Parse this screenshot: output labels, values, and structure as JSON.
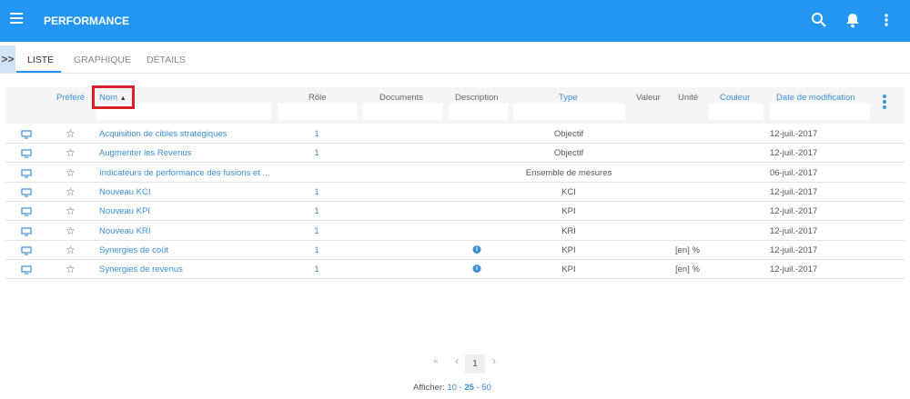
{
  "header": {
    "title": "PERFORMANCE",
    "icons": [
      "menu-icon",
      "search-icon",
      "bell-icon",
      "more-vert-icon"
    ]
  },
  "tabs": [
    {
      "label": "LISTE",
      "active": true
    },
    {
      "label": "GRAPHIQUE"
    },
    {
      "label": "DÉTAILS"
    }
  ],
  "expander": ">>",
  "columns": {
    "prefere": "Préféré",
    "nom": "Nom",
    "role": "Rôle",
    "documents": "Documents",
    "description": "Description",
    "type": "Type",
    "valeur": "Valeur",
    "unite": "Unité",
    "couleur": "Couleur",
    "date": "Date de modification"
  },
  "sort": {
    "column": "Nom",
    "direction": "ascending"
  },
  "rows": [
    {
      "name": "Acquisition de cibles stratégiques",
      "role": "1",
      "info": false,
      "type": "Objectif",
      "unit": "",
      "date": "12-juil.-2017"
    },
    {
      "name": "Augmenter les Revenus",
      "role": "1",
      "info": false,
      "type": "Objectif",
      "unit": "",
      "date": "12-juil.-2017"
    },
    {
      "name": "Indicateurs de performance des fusions et ...",
      "role": "",
      "info": false,
      "type": "Ensemble de mesures",
      "unit": "",
      "date": "06-juil.-2017"
    },
    {
      "name": "Nouveau KCI",
      "role": "1",
      "info": false,
      "type": "KCI",
      "unit": "",
      "date": "12-juil.-2017"
    },
    {
      "name": "Nouveau KPI",
      "role": "1",
      "info": false,
      "type": "KPI",
      "unit": "",
      "date": "12-juil.-2017"
    },
    {
      "name": "Nouveau KRI",
      "role": "1",
      "info": false,
      "type": "KRI",
      "unit": "",
      "date": "12-juil.-2017"
    },
    {
      "name": "Synergies de coût",
      "role": "1",
      "info": true,
      "type": "KPI",
      "unit": "[en] %",
      "date": "12-juil.-2017"
    },
    {
      "name": "Synergies de revenus",
      "role": "1",
      "info": true,
      "type": "KPI",
      "unit": "[en] %",
      "date": "12-juil.-2017"
    }
  ],
  "pagination": {
    "first": "«",
    "prev": "‹",
    "page": "1",
    "next": "›",
    "show_label": "Afficher:",
    "sizes": [
      "10",
      "25",
      "50"
    ],
    "selected_size": "25"
  },
  "colors": {
    "primary": "#2196f3",
    "link": "#3a8fd6",
    "highlight": "#d9202a"
  }
}
